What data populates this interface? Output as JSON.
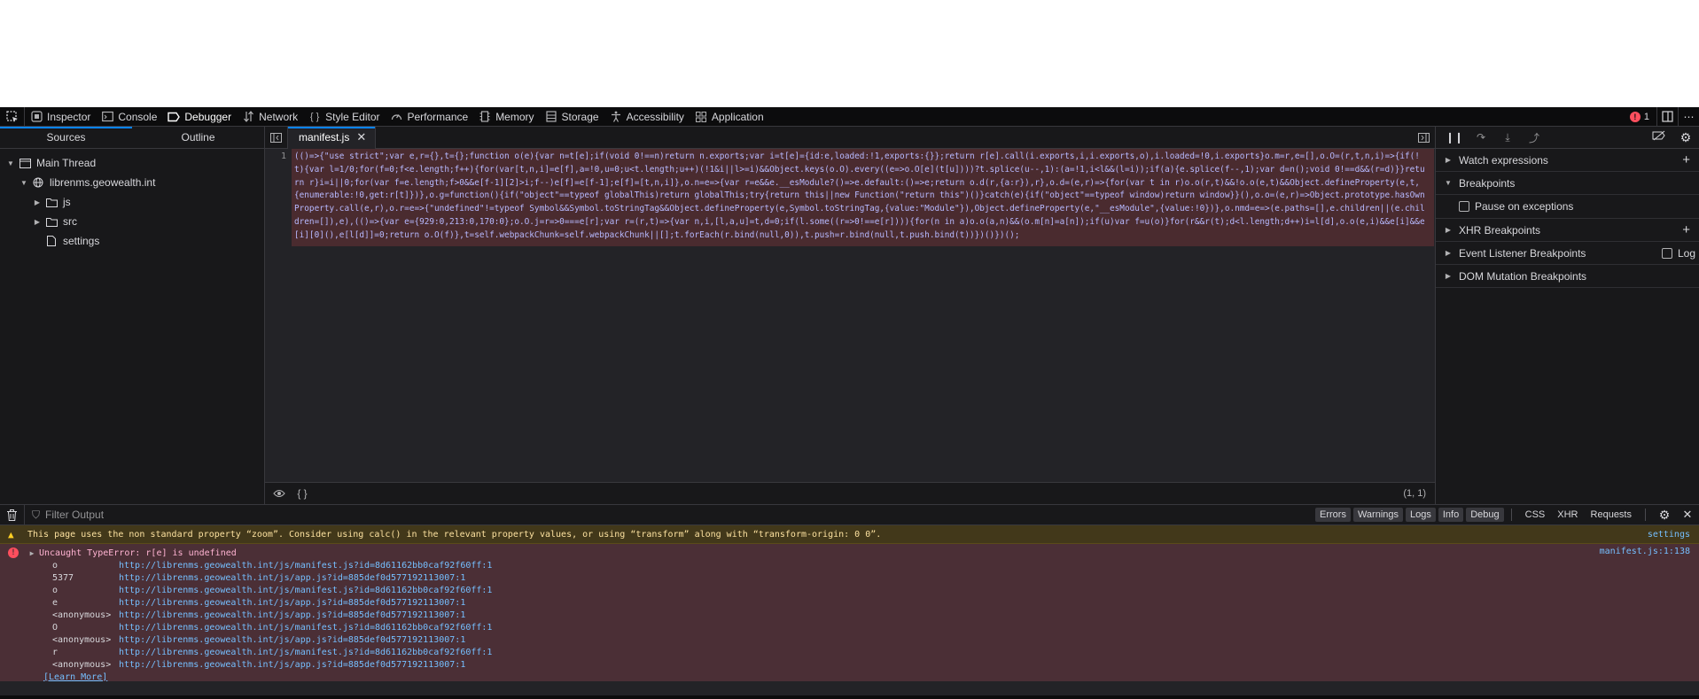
{
  "toolbar": {
    "tabs": [
      {
        "label": "Inspector",
        "icon": "inspector-icon"
      },
      {
        "label": "Console",
        "icon": "console-icon"
      },
      {
        "label": "Debugger",
        "icon": "debugger-icon"
      },
      {
        "label": "Network",
        "icon": "network-icon"
      },
      {
        "label": "Style Editor",
        "icon": "style-editor-icon"
      },
      {
        "label": "Performance",
        "icon": "performance-icon"
      },
      {
        "label": "Memory",
        "icon": "memory-icon"
      },
      {
        "label": "Storage",
        "icon": "storage-icon"
      },
      {
        "label": "Accessibility",
        "icon": "accessibility-icon"
      },
      {
        "label": "Application",
        "icon": "application-icon"
      }
    ],
    "selected_tab": "Debugger",
    "error_count": "1"
  },
  "sources": {
    "tabs": [
      "Sources",
      "Outline"
    ],
    "tree": {
      "thread": "Main Thread",
      "domain": "librenms.geowealth.int",
      "items": [
        "js",
        "src",
        "settings"
      ]
    }
  },
  "editor": {
    "tab_label": "manifest.js",
    "line_number": "1",
    "code": "(()=>{\"use strict\";var e,r={},t={};function o(e){var n=t[e];if(void 0!==n)return n.exports;var i=t[e]={id:e,loaded:!1,exports:{}};return r[e].call(i.exports,i,i.exports,o),i.loaded=!0,i.exports}o.m=r,e=[],o.O=(r,t,n,i)=>{if(!t){var l=1/0;for(f=0;f<e.length;f++){for(var[t,n,i]=e[f],a=!0,u=0;u<t.length;u++)(!1&i||l>=i)&&Object.keys(o.O).every((e=>o.O[e](t[u])))?t.splice(u--,1):(a=!1,i<l&&(l=i));if(a){e.splice(f--,1);var d=n();void 0!==d&&(r=d)}}return r}i=i||0;for(var f=e.length;f>0&&e[f-1][2]>i;f--)e[f]=e[f-1];e[f]=[t,n,i]},o.n=e=>{var r=e&&e.__esModule?()=>e.default:()=>e;return o.d(r,{a:r}),r},o.d=(e,r)=>{for(var t in r)o.o(r,t)&&!o.o(e,t)&&Object.defineProperty(e,t,{enumerable:!0,get:r[t]})},o.g=function(){if(\"object\"==typeof globalThis)return globalThis;try{return this||new Function(\"return this\")()}catch(e){if(\"object\"==typeof window)return window}}(),o.o=(e,r)=>Object.prototype.hasOwnProperty.call(e,r),o.r=e=>{\"undefined\"!=typeof Symbol&&Symbol.toStringTag&&Object.defineProperty(e,Symbol.toStringTag,{value:\"Module\"}),Object.defineProperty(e,\"__esModule\",{value:!0})},o.nmd=e=>(e.paths=[],e.children||(e.children=[]),e),(()=>{var e={929:0,213:0,170:0};o.O.j=r=>0===e[r];var r=(r,t)=>{var n,i,[l,a,u]=t,d=0;if(l.some((r=>0!==e[r]))){for(n in a)o.o(a,n)&&(o.m[n]=a[n]);if(u)var f=u(o)}for(r&&r(t);d<l.length;d++)i=l[d],o.o(e,i)&&e[i]&&e[i][0](),e[l[d]]=0;return o.O(f)},t=self.webpackChunk=self.webpackChunk||[];t.forEach(r.bind(null,0)),t.push=r.bind(null,t.push.bind(t))})()})();",
    "footer_braces": "{ }",
    "cursor_position": "(1, 1)"
  },
  "sidebar": {
    "watch_expressions": "Watch expressions",
    "breakpoints": "Breakpoints",
    "pause_on_exceptions": "Pause on exceptions",
    "xhr_breakpoints": "XHR Breakpoints",
    "event_listener_breakpoints": "Event Listener Breakpoints",
    "log_label": "Log",
    "dom_mutation_breakpoints": "DOM Mutation Breakpoints"
  },
  "console": {
    "filter_placeholder": "Filter Output",
    "filter_buttons": [
      "Errors",
      "Warnings",
      "Logs",
      "Info",
      "Debug"
    ],
    "extra_filters": [
      "CSS",
      "XHR",
      "Requests"
    ],
    "warning": {
      "text": "This page uses the non standard property “zoom”. Consider using calc() in the relevant property values, or using “transform” along with “transform-origin: 0 0”.",
      "link": "settings"
    },
    "error": {
      "message": "Uncaught TypeError: r[e] is undefined",
      "source": "manifest.js:1:138",
      "stack": [
        {
          "fn": "o",
          "url": "http://librenms.geowealth.int/js/manifest.js?id=8d61162bb0caf92f60ff:1"
        },
        {
          "fn": "5377",
          "url": "http://librenms.geowealth.int/js/app.js?id=885def0d577192113007:1"
        },
        {
          "fn": "o",
          "url": "http://librenms.geowealth.int/js/manifest.js?id=8d61162bb0caf92f60ff:1"
        },
        {
          "fn": "e",
          "url": "http://librenms.geowealth.int/js/app.js?id=885def0d577192113007:1"
        },
        {
          "fn": "<anonymous>",
          "url": "http://librenms.geowealth.int/js/app.js?id=885def0d577192113007:1"
        },
        {
          "fn": "O",
          "url": "http://librenms.geowealth.int/js/manifest.js?id=8d61162bb0caf92f60ff:1"
        },
        {
          "fn": "<anonymous>",
          "url": "http://librenms.geowealth.int/js/app.js?id=885def0d577192113007:1"
        },
        {
          "fn": "r",
          "url": "http://librenms.geowealth.int/js/manifest.js?id=8d61162bb0caf92f60ff:1"
        },
        {
          "fn": "<anonymous>",
          "url": "http://librenms.geowealth.int/js/app.js?id=885def0d577192113007:1"
        }
      ],
      "learn_more": "[Learn More]"
    }
  },
  "colors": {
    "accent": "#0a84ff",
    "error": "#ff4f5e",
    "warning": "#ffd024",
    "link": "#75bfff"
  }
}
